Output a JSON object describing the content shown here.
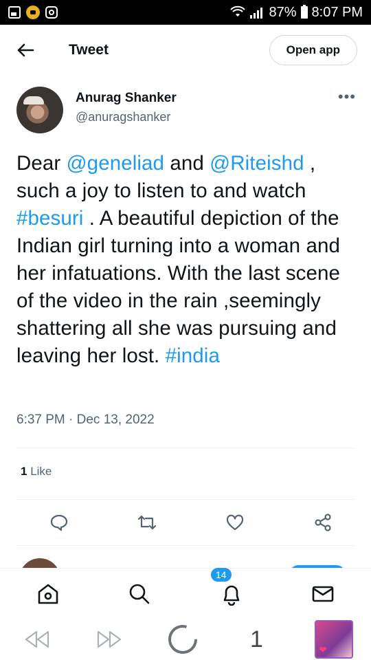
{
  "status_bar": {
    "battery": "87%",
    "time": "8:07 PM"
  },
  "header": {
    "title": "Tweet",
    "open_app_label": "Open app"
  },
  "author": {
    "name": "Anurag Shanker",
    "handle": "@anuragshanker",
    "more_label": "•••"
  },
  "tweet": {
    "parts": [
      {
        "text": "Dear ",
        "type": "text"
      },
      {
        "text": "@geneliad",
        "type": "link"
      },
      {
        "text": " and ",
        "type": "text"
      },
      {
        "text": "@Riteishd",
        "type": "link"
      },
      {
        "text": " , such a joy to listen to and watch ",
        "type": "text"
      },
      {
        "text": "#besuri",
        "type": "link"
      },
      {
        "text": " . A beautiful depiction of the Indian girl turning into a woman and her infatuations. With the last scene of the video in the rain ,seemingly shattering all she was pursuing and leaving her lost. ",
        "type": "text"
      },
      {
        "text": "#india",
        "type": "link"
      }
    ],
    "timestamp": "6:37 PM · Dec 13, 2022",
    "likes_count": "1",
    "likes_label": " Like"
  },
  "bottom_nav": {
    "notifications_badge": "14"
  },
  "system_bar": {
    "tab_count": "1"
  },
  "colors": {
    "accent": "#1d9bf0",
    "text": "#0f1419",
    "muted": "#536471"
  }
}
